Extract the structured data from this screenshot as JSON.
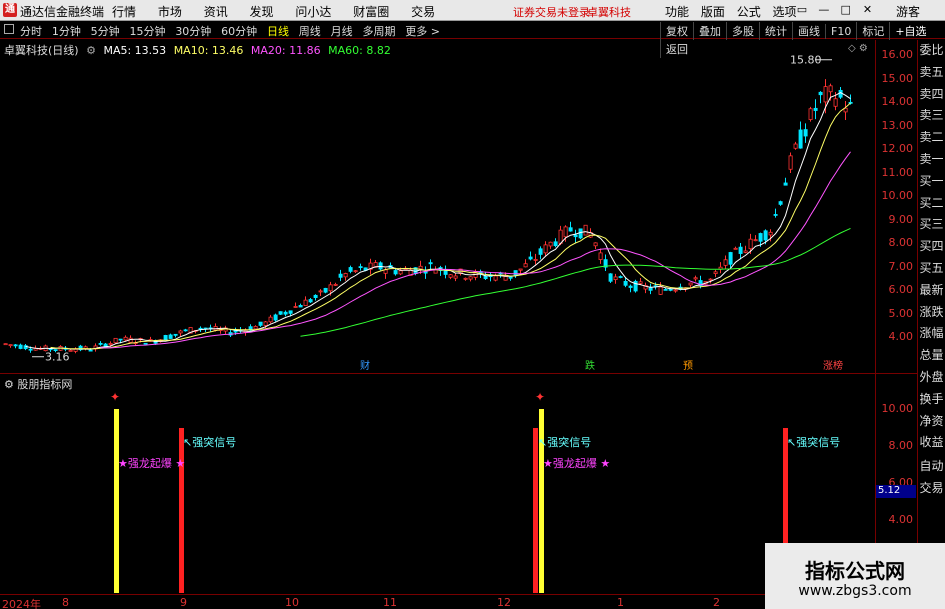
{
  "titlebar": {
    "app_name": "通达信金融终端",
    "menu": [
      "行情",
      "市场",
      "资讯",
      "发现",
      "问小达",
      "财富圈",
      "交易"
    ],
    "warning": "证券交易未登录",
    "stock": "卓翼科技",
    "right_menu": [
      "功能",
      "版面",
      "公式",
      "选项"
    ],
    "window_buttons": [
      "▭",
      "—",
      "□",
      "✕"
    ],
    "guest": "游客"
  },
  "periodbar": {
    "periods": [
      "分时",
      "1分钟",
      "5分钟",
      "15分钟",
      "30分钟",
      "60分钟",
      "日线",
      "周线",
      "月线",
      "多周期",
      "更多 >"
    ],
    "active_index": 6,
    "tools": [
      "复权",
      "叠加",
      "多股",
      "统计",
      "画线",
      "F10",
      "标记",
      "+自选",
      "返回"
    ]
  },
  "legend": {
    "stock_name": "卓翼科技(日线)",
    "ma5": "MA5: 13.53",
    "ma10": "MA10: 13.46",
    "ma20": "MA20: 11.86",
    "ma60": "MA60: 8.82"
  },
  "price_axis": [
    "16.00",
    "15.00",
    "14.00",
    "13.00",
    "12.00",
    "11.00",
    "10.00",
    "9.00",
    "8.00",
    "7.00",
    "6.00",
    "5.00",
    "4.00"
  ],
  "chart_notes": {
    "high_label": "15.80",
    "low_label": "3.16",
    "markers": [
      "财",
      "跌",
      "预",
      "涨榜"
    ]
  },
  "side_panel": [
    "委比",
    "卖五",
    "卖四",
    "卖三",
    "卖二",
    "卖一",
    "买一",
    "买二",
    "买三",
    "买四",
    "买五",
    "最新",
    "涨跌",
    "涨幅",
    "总量",
    "外盘",
    "换手",
    "净资",
    "收益",
    "自动",
    "交易"
  ],
  "indicator": {
    "name": "股朋指标网",
    "axis": [
      "10.00",
      "8.00",
      "6.00",
      "4.00"
    ],
    "current_value": "5.12",
    "signal_strong": "强突信号",
    "signal_dragon": "强龙起爆"
  },
  "time_axis": [
    "2024年",
    "8",
    "9",
    "10",
    "11",
    "12",
    "1",
    "2"
  ],
  "watermark": {
    "line1": "指标公式网",
    "line2": "www.zbgs3.com"
  }
}
